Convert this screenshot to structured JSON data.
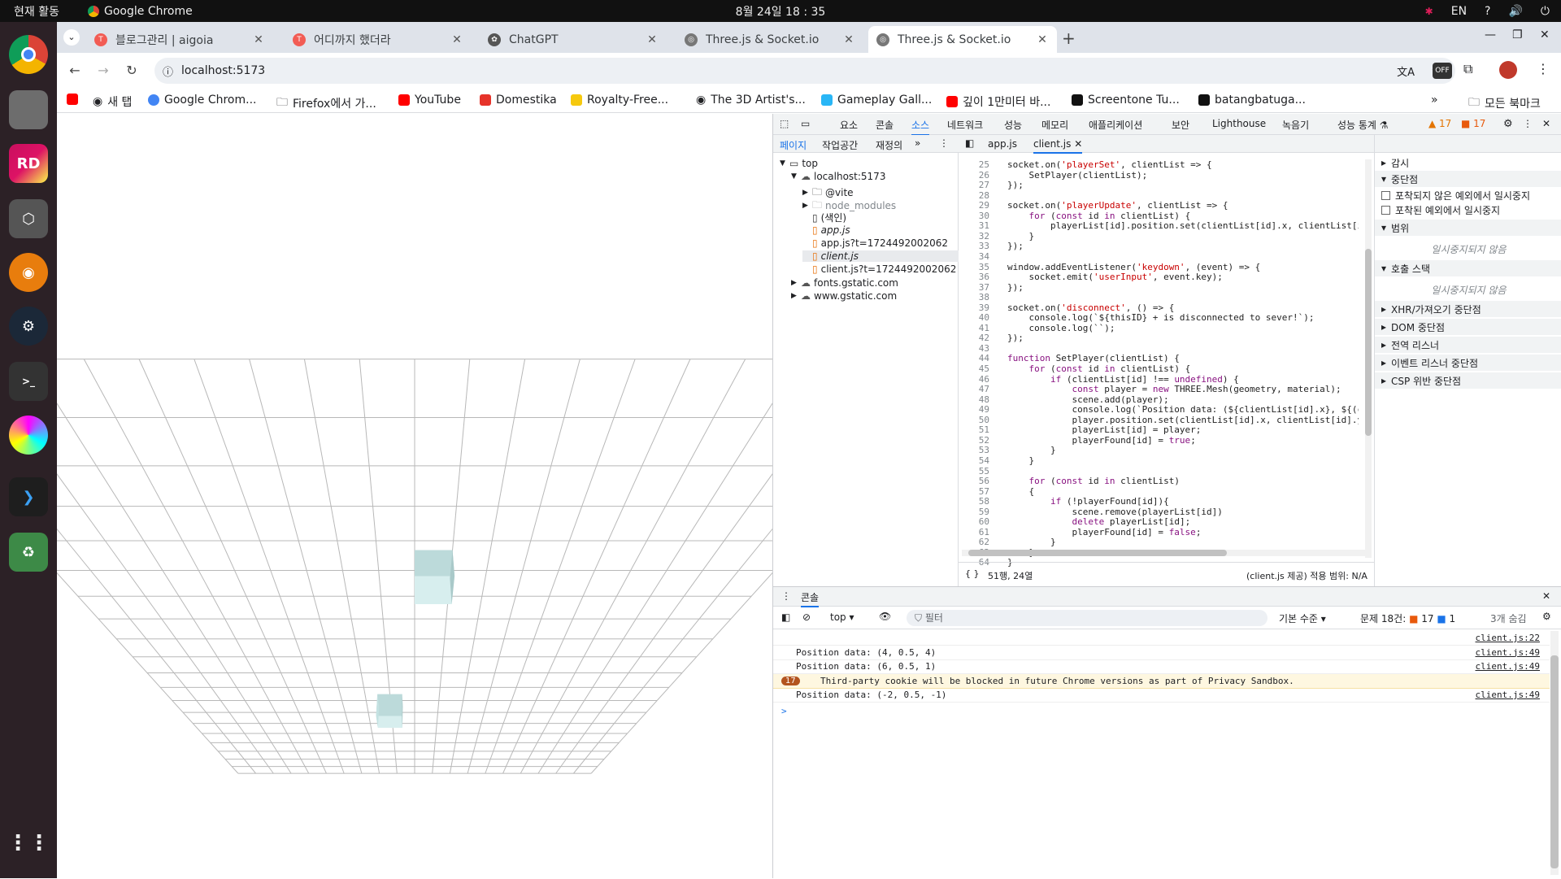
{
  "topbar": {
    "activities": "현재 활동",
    "app": "Google Chrome",
    "clock": "8월 24일  18 : 35",
    "lang": "EN"
  },
  "tabs": [
    {
      "title": "블로그관리 | aigoia",
      "color": "#f25c54"
    },
    {
      "title": "어디까지 했더라",
      "color": "#f25c54"
    },
    {
      "title": "ChatGPT",
      "color": "#555555"
    },
    {
      "title": "Three.js & Socket.io",
      "color": "#555555"
    },
    {
      "title": "Three.js & Socket.io",
      "color": "#555555"
    }
  ],
  "url": "localhost:5173",
  "bookmarks": [
    "새 탭",
    "Google Chrom...",
    "Firefox에서 가...",
    "YouTube",
    "Domestika",
    "Royalty-Free...",
    "The 3D Artist's...",
    "Gameplay Gall...",
    "깊이 1만미터 바...",
    "Screentone Tu...",
    "batangbatuga..."
  ],
  "all_bookmarks": "모든 북마크",
  "devtools": {
    "tabs": [
      "요소",
      "콘솔",
      "소스",
      "네트워크",
      "성능",
      "메모리",
      "애플리케이션",
      "보안",
      "Lighthouse",
      "녹음기",
      "성능 통계 ⚗"
    ],
    "warn_count": "17",
    "err_count": "17",
    "nav_tabs": [
      "페이지",
      "작업공간",
      "재정의"
    ],
    "tree": [
      {
        "label": "top",
        "depth": 0,
        "kind": "frame",
        "arrow": "▼"
      },
      {
        "label": "localhost:5173",
        "depth": 1,
        "kind": "cloud",
        "arrow": "▼"
      },
      {
        "label": "@vite",
        "depth": 2,
        "kind": "folder",
        "arrow": "▶"
      },
      {
        "label": "node_modules",
        "depth": 2,
        "kind": "folder-dim",
        "arrow": "▶"
      },
      {
        "label": "(색인)",
        "depth": 2,
        "kind": "file",
        "arrow": ""
      },
      {
        "label": "app.js",
        "depth": 2,
        "kind": "js",
        "arrow": ""
      },
      {
        "label": "app.js?t=1724492002062",
        "depth": 2,
        "kind": "js",
        "arrow": ""
      },
      {
        "label": "client.js",
        "depth": 2,
        "kind": "js-sel",
        "arrow": ""
      },
      {
        "label": "client.js?t=1724492002062",
        "depth": 2,
        "kind": "js",
        "arrow": ""
      },
      {
        "label": "fonts.gstatic.com",
        "depth": 1,
        "kind": "cloud",
        "arrow": "▶"
      },
      {
        "label": "www.gstatic.com",
        "depth": 1,
        "kind": "cloud",
        "arrow": "▶"
      }
    ],
    "editor_tabs": [
      "app.js",
      "client.js"
    ],
    "code": [
      [
        "25",
        "socket.on('playerSet', clientList => {"
      ],
      [
        "26",
        "    SetPlayer(clientList);"
      ],
      [
        "27",
        "});"
      ],
      [
        "28",
        ""
      ],
      [
        "29",
        "socket.on('playerUpdate', clientList => {"
      ],
      [
        "30",
        "    for (const id in clientList) {"
      ],
      [
        "31",
        "        playerList[id].position.set(clientList[id].x, clientList[id]"
      ],
      [
        "32",
        "    }"
      ],
      [
        "33",
        "});"
      ],
      [
        "34",
        ""
      ],
      [
        "35",
        "window.addEventListener('keydown', (event) => {"
      ],
      [
        "36",
        "    socket.emit('userInput', event.key);"
      ],
      [
        "37",
        "});"
      ],
      [
        "38",
        ""
      ],
      [
        "39",
        "socket.on('disconnect', () => {"
      ],
      [
        "40",
        "    console.log(`${thisID} + is disconnected to sever!`);"
      ],
      [
        "41",
        "    console.log(``);"
      ],
      [
        "42",
        "});"
      ],
      [
        "43",
        ""
      ],
      [
        "44",
        "function SetPlayer(clientList) {"
      ],
      [
        "45",
        "    for (const id in clientList) {"
      ],
      [
        "46",
        "        if (clientList[id] !== undefined) {"
      ],
      [
        "47",
        "            const player = new THREE.Mesh(geometry, material);"
      ],
      [
        "48",
        "            scene.add(player);"
      ],
      [
        "49",
        "            console.log(`Position data: (${clientList[id].x}, ${(clie"
      ],
      [
        "50",
        "            player.position.set(clientList[id].x, clientList[id].y,"
      ],
      [
        "51",
        "            playerList[id] = player;"
      ],
      [
        "52",
        "            playerFound[id] = true;"
      ],
      [
        "53",
        "        }"
      ],
      [
        "54",
        "    }"
      ],
      [
        "55",
        ""
      ],
      [
        "56",
        "    for (const id in clientList)"
      ],
      [
        "57",
        "    {"
      ],
      [
        "58",
        "        if (!playerFound[id]){"
      ],
      [
        "59",
        "            scene.remove(playerList[id])"
      ],
      [
        "60",
        "            delete playerList[id];"
      ],
      [
        "61",
        "            playerFound[id] = false;"
      ],
      [
        "62",
        "        }"
      ],
      [
        "63",
        "    }"
      ],
      [
        "64",
        "}"
      ]
    ],
    "status_pos": "51행, 24열",
    "status_src": "(client.js 제공) 적용 범위: N/A",
    "debugger": {
      "watch": "감시",
      "breakpoints": "중단점",
      "pause_uncaught": "포착되지 않은 예외에서 일시중지",
      "pause_caught": "포착된 예외에서 일시중지",
      "scope": "범위",
      "not_paused": "일시중지되지 않음",
      "callstack": "호출 스택",
      "xhr": "XHR/가져오기 중단점",
      "dom": "DOM 중단점",
      "global": "전역 리스너",
      "event": "이벤트 리스너 중단점",
      "csp": "CSP 위반 중단점"
    },
    "drawer": {
      "title": "콘솔",
      "context": "top",
      "filter_placeholder": "필터",
      "level": "기본 수준",
      "issues": "문제 18건:",
      "issue_warn": "17",
      "issue_info": "1",
      "hidden": "3개 숨김",
      "rows": [
        {
          "msg": "",
          "src": "client.js:22",
          "kind": "log"
        },
        {
          "msg": "Position data: (4, 0.5, 4)",
          "src": "client.js:49",
          "kind": "log"
        },
        {
          "msg": "Position data: (6, 0.5, 1)",
          "src": "client.js:49",
          "kind": "log"
        },
        {
          "msg": "Third-party cookie will be blocked in future Chrome versions as part of Privacy Sandbox.",
          "src": "",
          "kind": "warn",
          "count": "17"
        },
        {
          "msg": "Position data: (-2, 0.5, -1)",
          "src": "client.js:49",
          "kind": "log"
        }
      ],
      "prompt": ">"
    }
  }
}
